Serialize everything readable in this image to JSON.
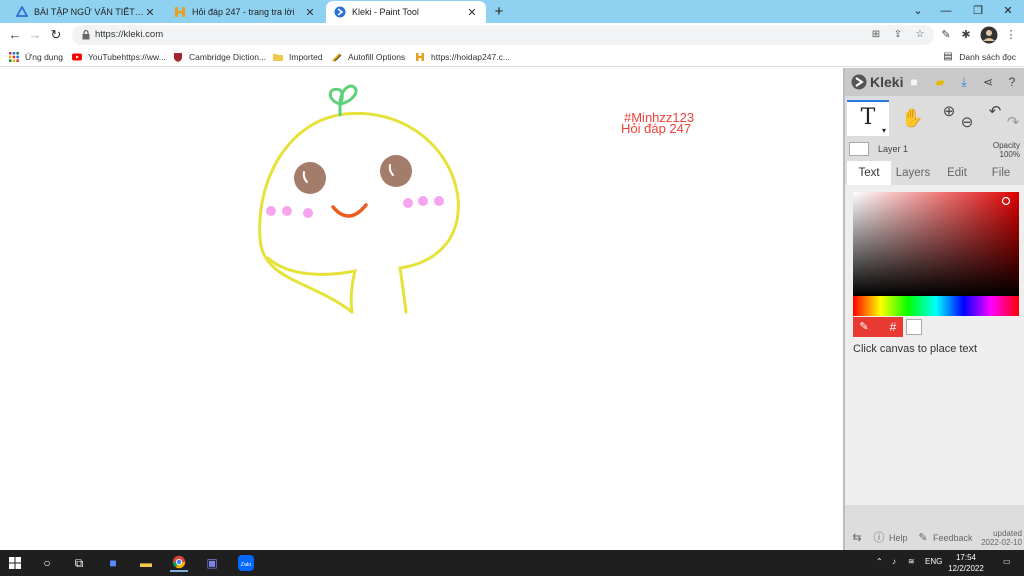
{
  "browser": {
    "tabs": [
      {
        "title": "BÀI TẬP NGỮ VĂN TIẾT 82- Lớp",
        "active": false
      },
      {
        "title": "Hỏi đáp 247 - trang tra lời",
        "active": false
      },
      {
        "title": "Kleki - Paint Tool",
        "active": true
      }
    ],
    "url": "https://kleki.com",
    "new_tab_symbol": "+",
    "bookmarks": [
      {
        "label": "Ứng dụng"
      },
      {
        "label": "YouTubehttps://ww..."
      },
      {
        "label": "Cambridge Diction..."
      },
      {
        "label": "Imported"
      },
      {
        "label": "Autofill Options"
      },
      {
        "label": "https://hoidap247.c..."
      }
    ],
    "reading_list": "Danh sách đọc"
  },
  "canvas": {
    "text_line1": "#Minhzz123",
    "text_line2": "Hỏi đáp 247",
    "text_color": "#f0413a"
  },
  "panel": {
    "app_name": "Kleki",
    "tool_symbol": "T",
    "layer_name": "Layer 1",
    "opacity_label": "Opacity",
    "opacity_value": "100%",
    "tabs": [
      "Text",
      "Layers",
      "Edit",
      "File"
    ],
    "active_tab": "Text",
    "hash_symbol": "#",
    "hint": "Click canvas to place text",
    "help_label": "Help",
    "feedback_label": "Feedback",
    "updated_label": "updated",
    "updated_date": "2022-02-10",
    "selected_color": "#e83a32"
  },
  "taskbar": {
    "language": "ENG",
    "time": "17:54",
    "date": "12/2/2022"
  }
}
